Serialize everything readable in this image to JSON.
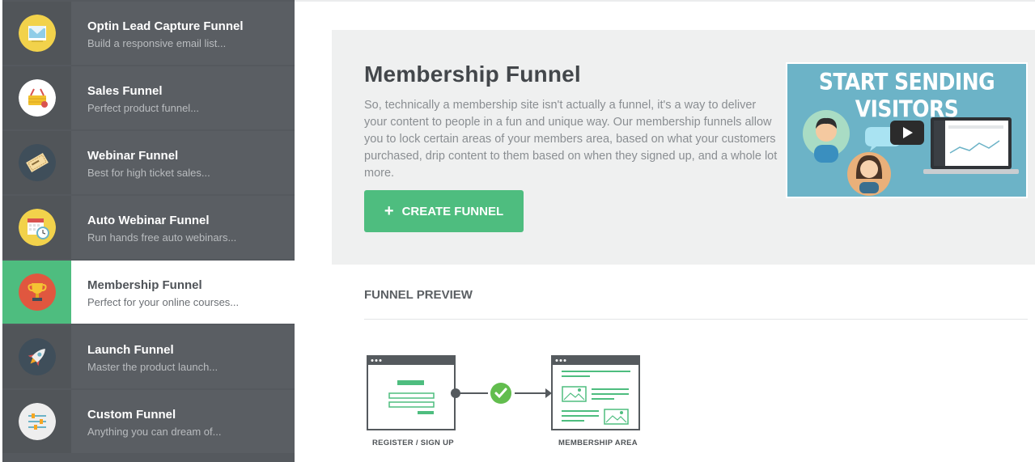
{
  "sidebar": {
    "items": [
      {
        "title": "Optin Lead Capture Funnel",
        "desc": "Build a responsive email list...",
        "icon": "email-envelope-icon",
        "active": false
      },
      {
        "title": "Sales Funnel",
        "desc": "Perfect product funnel...",
        "icon": "shopping-basket-icon",
        "active": false
      },
      {
        "title": "Webinar Funnel",
        "desc": "Best for high ticket sales...",
        "icon": "ticket-icon",
        "active": false
      },
      {
        "title": "Auto Webinar Funnel",
        "desc": "Run hands free auto webinars...",
        "icon": "calendar-clock-icon",
        "active": false
      },
      {
        "title": "Membership Funnel",
        "desc": "Perfect for your online courses...",
        "icon": "trophy-icon",
        "active": true
      },
      {
        "title": "Launch Funnel",
        "desc": "Master the product launch...",
        "icon": "rocket-icon",
        "active": false
      },
      {
        "title": "Custom Funnel",
        "desc": "Anything you can dream of...",
        "icon": "sliders-icon",
        "active": false
      }
    ]
  },
  "hero": {
    "title": "Membership Funnel",
    "description": "So, technically a membership site isn't actually a funnel, it's a way to deliver your content to people in a fun and unique way. Our membership funnels allow you to lock certain areas of your members area, based on what your customers purchased, drip content to them based on when they signed up, and a whole lot more.",
    "create_button": "CREATE FUNNEL",
    "create_icon": "plus-icon"
  },
  "video": {
    "title": "START SENDING VISITORS",
    "play_icon": "play-icon"
  },
  "preview": {
    "label": "FUNNEL PREVIEW",
    "steps": [
      {
        "label": "REGISTER / SIGN UP"
      },
      {
        "label": "MEMBERSHIP AREA"
      }
    ]
  },
  "colors": {
    "accent": "#4ebd7f",
    "sidebar_bg": "#5a5e63",
    "hero_bg": "#eff0f0",
    "video_bg": "#6cb3c7"
  }
}
